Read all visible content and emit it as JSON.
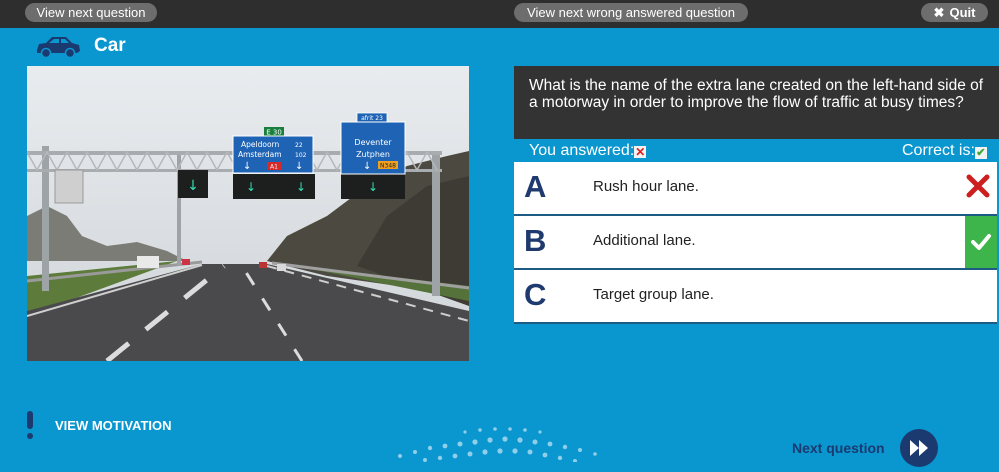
{
  "topbar": {
    "next_label": "View next question",
    "wrong_label": "View next wrong answered question",
    "quit_label": "Quit"
  },
  "category": {
    "title": "Car",
    "icon": "car-icon"
  },
  "question": {
    "text": "What is the name of the extra lane created on the left-hand side of a motorway in order to improve the flow of traffic at busy times?"
  },
  "photo": {
    "signs": {
      "route_code_left": "E 30",
      "left_line1": "Apeldoorn",
      "left_line1_num": "22",
      "left_line2": "Amsterdam",
      "left_line2_num": "102",
      "left_badge": "A1",
      "right_exit": "afrit 23",
      "right_line1": "Deventer",
      "right_line2": "Zutphen",
      "right_badge": "N348"
    }
  },
  "answers": {
    "you_answered": "You answered:",
    "correct_is": "Correct is:",
    "options": [
      {
        "letter": "A",
        "text": "Rush hour lane.",
        "status": "wrong"
      },
      {
        "letter": "B",
        "text": "Additional lane.",
        "status": "correct"
      },
      {
        "letter": "C",
        "text": "Target group lane.",
        "status": "none"
      }
    ]
  },
  "footer": {
    "motivation_label": "VIEW MOTIVATION",
    "next_label": "Next question"
  },
  "colors": {
    "background": "#0a96cf",
    "topbar": "#2e2e2e",
    "dark_blue": "#1a3a70",
    "correct_green": "#3eb54a",
    "wrong_red": "#cc1f1f"
  }
}
